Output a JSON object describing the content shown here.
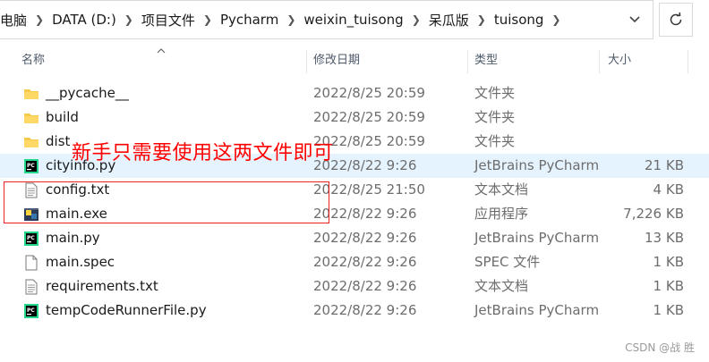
{
  "breadcrumb": [
    "电脑",
    "DATA (D:)",
    "项目文件",
    "Pycharm",
    "weixin_tuisong",
    "呆瓜版",
    "tuisong"
  ],
  "columns": {
    "name": "名称",
    "date": "修改日期",
    "type": "类型",
    "size": "大小"
  },
  "files": [
    {
      "name": "__pycache__",
      "date": "2022/8/25 20:59",
      "type": "文件夹",
      "size": "",
      "icon": "folder-icon"
    },
    {
      "name": "build",
      "date": "2022/8/25 20:59",
      "type": "文件夹",
      "size": "",
      "icon": "folder-icon"
    },
    {
      "name": "dist",
      "date": "2022/8/25 20:59",
      "type": "文件夹",
      "size": "",
      "icon": "folder-icon"
    },
    {
      "name": "cityinfo.py",
      "date": "2022/8/22 9:26",
      "type": "JetBrains PyCharm",
      "size": "21 KB",
      "icon": "pycharm-file-icon"
    },
    {
      "name": "config.txt",
      "date": "2022/8/25 21:50",
      "type": "文本文档",
      "size": "4 KB",
      "icon": "text-file-icon"
    },
    {
      "name": "main.exe",
      "date": "2022/8/22 9:26",
      "type": "应用程序",
      "size": "7,226 KB",
      "icon": "exe-file-icon"
    },
    {
      "name": "main.py",
      "date": "2022/8/22 9:26",
      "type": "JetBrains PyCharm",
      "size": "13 KB",
      "icon": "pycharm-file-icon"
    },
    {
      "name": "main.spec",
      "date": "2022/8/22 9:26",
      "type": "SPEC 文件",
      "size": "1 KB",
      "icon": "generic-file-icon"
    },
    {
      "name": "requirements.txt",
      "date": "2022/8/22 9:26",
      "type": "文本文档",
      "size": "1 KB",
      "icon": "text-file-icon"
    },
    {
      "name": "tempCodeRunnerFile.py",
      "date": "2022/8/22 9:26",
      "type": "JetBrains PyCharm",
      "size": "1 KB",
      "icon": "pycharm-file-icon"
    }
  ],
  "annotation": "新手只需要使用这两文件即可",
  "watermark": "CSDN @战 胜",
  "colors": {
    "annotation": "#ff0000",
    "highlight": "#e5f3ff",
    "folder": "#f7c948",
    "pycharm": "#21d789"
  }
}
